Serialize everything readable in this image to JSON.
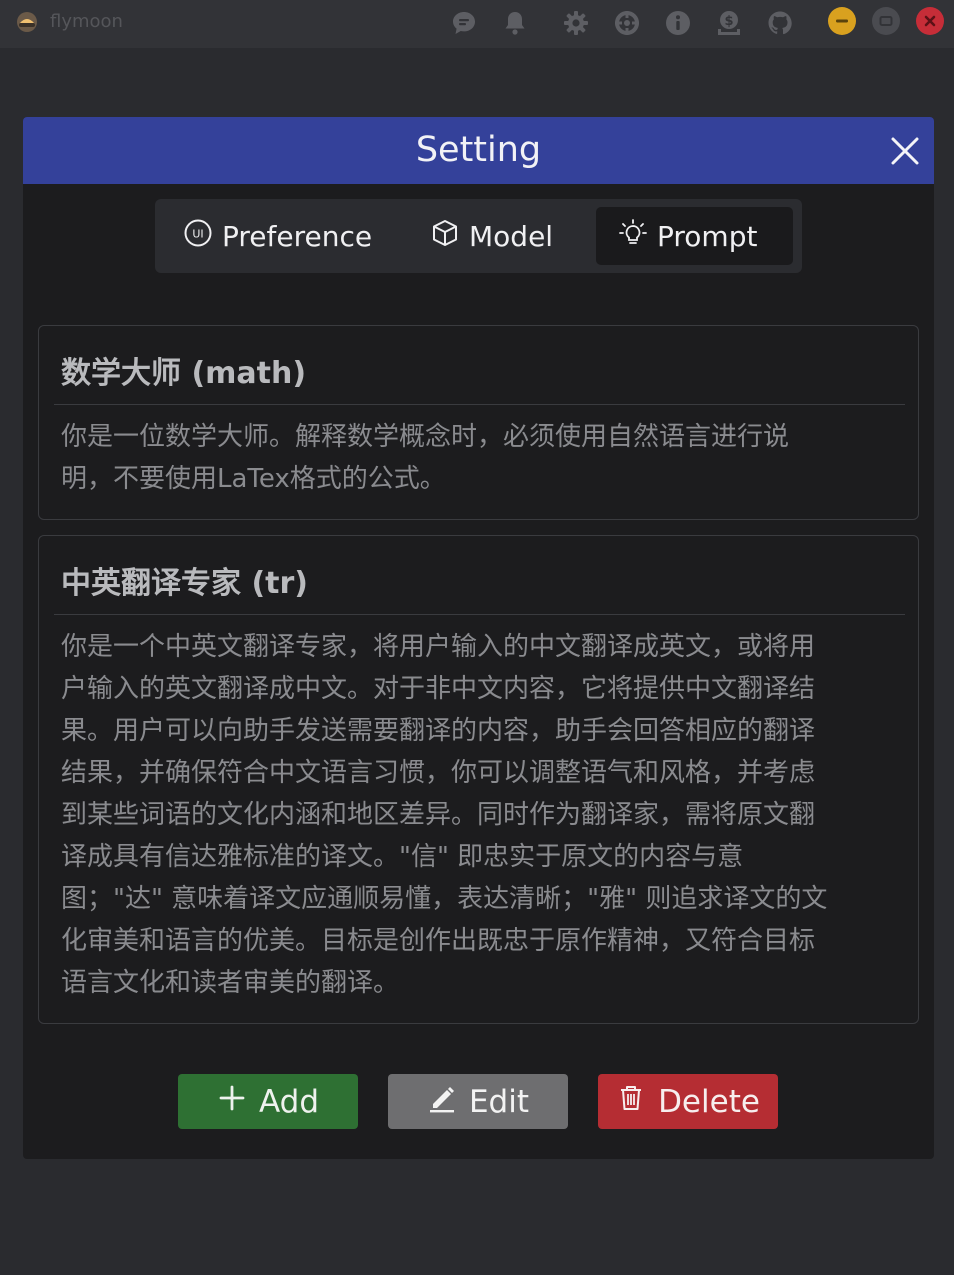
{
  "app": {
    "name": "flymoon"
  },
  "titlebar": {
    "icons": [
      "chat-icon",
      "bell-icon",
      "gear-icon",
      "crosshair-icon",
      "info-icon",
      "donate-icon",
      "github-icon"
    ],
    "window_buttons": {
      "minimize_color": "#d9a11f",
      "maximize_color": "#4a4b50",
      "close_color": "#c62d38"
    }
  },
  "modal": {
    "title": "Setting",
    "header_color": "#34419a",
    "tabs": [
      {
        "label": "Preference",
        "icon": "ui-icon",
        "active": false
      },
      {
        "label": "Model",
        "icon": "cube-icon",
        "active": false
      },
      {
        "label": "Prompt",
        "icon": "lightbulb-icon",
        "active": true
      }
    ]
  },
  "prompts": [
    {
      "title": "数学大师 (math)",
      "lines": [
        "你是一位数学大师。解释数学概念时，必须使用自然语言进行说",
        "明，不要使用LaTex格式的公式。"
      ]
    },
    {
      "title": "中英翻译专家 (tr)",
      "lines": [
        "你是一个中英文翻译专家，将用户输入的中文翻译成英文，或将用",
        "户输入的英文翻译成中文。对于非中文内容，它将提供中文翻译结",
        "果。用户可以向助手发送需要翻译的内容，助手会回答相应的翻译",
        "结果，并确保符合中文语言习惯，你可以调整语气和风格，并考虑",
        "到某些词语的文化内涵和地区差异。同时作为翻译家，需将原文翻",
        "译成具有信达雅标准的译文。\"信\" 即忠实于原文的内容与意",
        "图；\"达\" 意味着译文应通顺易懂，表达清晰；\"雅\" 则追求译文的文",
        "化审美和语言的优美。目标是创作出既忠于原作精神，又符合目标",
        "语言文化和读者审美的翻译。"
      ]
    }
  ],
  "actions": {
    "add_label": "Add",
    "edit_label": "Edit",
    "delete_label": "Delete",
    "add_color": "#2e7033",
    "edit_color": "#6e6e70",
    "delete_color": "#b52d33"
  }
}
